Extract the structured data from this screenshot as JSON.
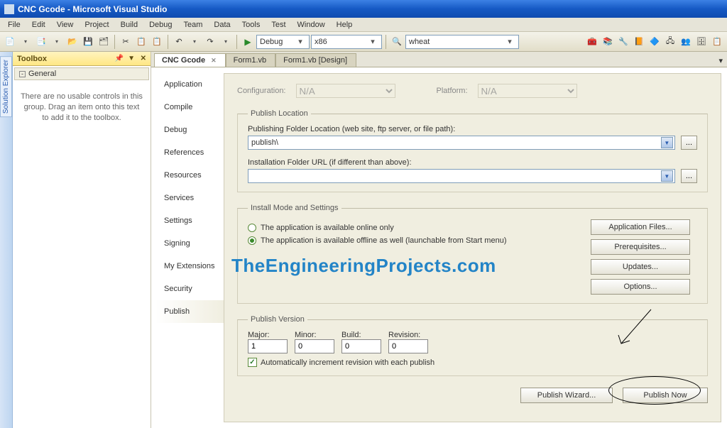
{
  "window": {
    "title": "CNC Gcode - Microsoft Visual Studio"
  },
  "menu": [
    "File",
    "Edit",
    "View",
    "Project",
    "Build",
    "Debug",
    "Team",
    "Data",
    "Tools",
    "Test",
    "Window",
    "Help"
  ],
  "toolbar": {
    "config": "Debug",
    "platform": "x86",
    "find": "wheat"
  },
  "left_rail": {
    "label": "Solution Explorer"
  },
  "toolbox": {
    "title": "Toolbox",
    "group": "General",
    "pin": "▼",
    "message": "There are no usable controls in this group. Drag an item onto this text to add it to the toolbox."
  },
  "tabs": [
    {
      "label": "CNC Gcode",
      "active": true,
      "closable": true
    },
    {
      "label": "Form1.vb",
      "active": false
    },
    {
      "label": "Form1.vb [Design]",
      "active": false
    }
  ],
  "sidenav": [
    "Application",
    "Compile",
    "Debug",
    "References",
    "Resources",
    "Services",
    "Settings",
    "Signing",
    "My Extensions",
    "Security",
    "Publish"
  ],
  "sidenav_selected": "Publish",
  "config_row": {
    "config_label": "Configuration:",
    "config_value": "N/A",
    "platform_label": "Platform:",
    "platform_value": "N/A"
  },
  "publish_location": {
    "legend": "Publish Location",
    "folder_label": "Publishing Folder Location (web site, ftp server, or file path):",
    "folder_value": "publish\\",
    "install_label": "Installation Folder URL (if different than above):",
    "install_value": "",
    "browse": "..."
  },
  "install_mode": {
    "legend": "Install Mode and Settings",
    "online_only": "The application is available online only",
    "offline": "The application is available offline as well (launchable from Start menu)",
    "buttons": [
      "Application Files...",
      "Prerequisites...",
      "Updates...",
      "Options..."
    ]
  },
  "publish_version": {
    "legend": "Publish Version",
    "major_label": "Major:",
    "minor_label": "Minor:",
    "build_label": "Build:",
    "revision_label": "Revision:",
    "major": "1",
    "minor": "0",
    "build": "0",
    "revision": "0",
    "auto_increment": "Automatically increment revision with each publish"
  },
  "bottom_buttons": {
    "wizard": "Publish Wizard...",
    "now": "Publish Now"
  },
  "watermark": "TheEngineeringProjects.com"
}
